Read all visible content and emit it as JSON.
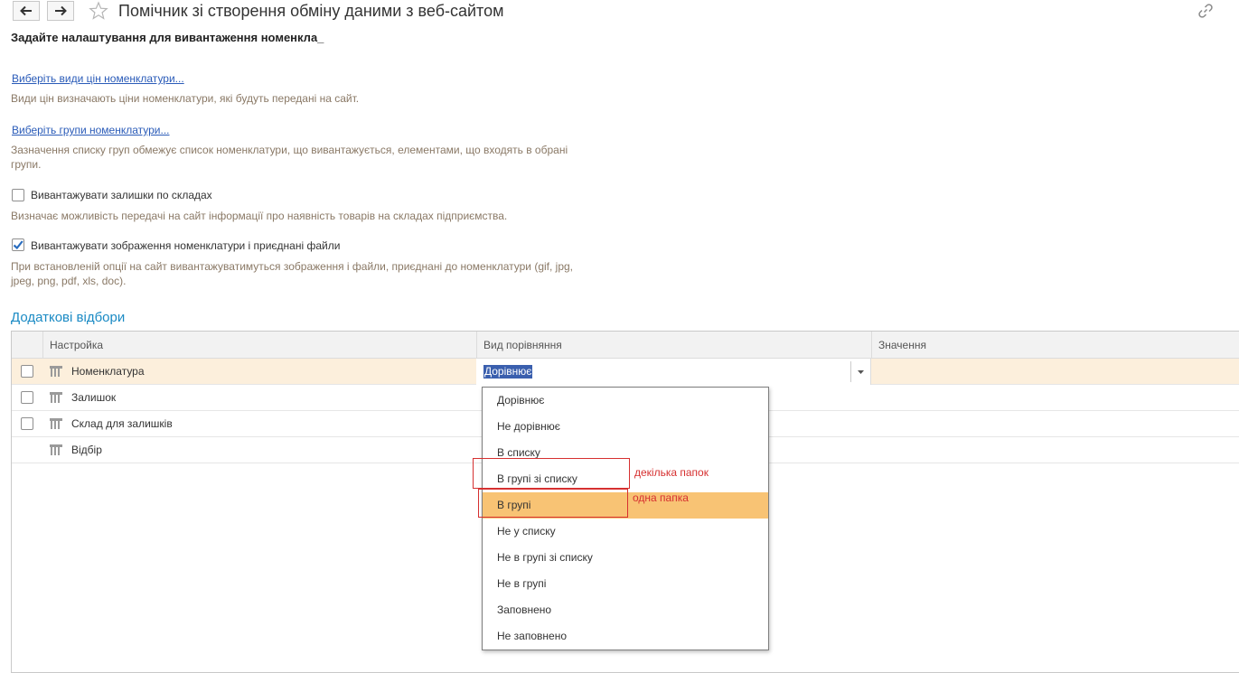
{
  "window": {
    "title": "Помічник зі створення обміну даними з веб-сайтом",
    "back_icon": "arrow-left-icon",
    "forward_icon": "arrow-right-icon",
    "favorite_icon": "star-icon",
    "link_icon": "link-icon"
  },
  "subtitle": "Задайте налаштування для вивантаження номенкла_",
  "price_types": {
    "link": "Виберіть види цін номенклатури...",
    "hint": "Види цін визначають ціни номенклатури, які будуть передані на сайт."
  },
  "groups": {
    "link": "Виберіть групи номенклатури...",
    "hint": "Зазначення списку груп обмежує список номенклатури, що вивантажується, елементами, що входять в обрані групи."
  },
  "stock_option": {
    "label": "Вивантажувати залишки по складах",
    "checked": false,
    "hint": "Визначає можливість передачі на сайт інформації про наявність товарів на складах підприємства."
  },
  "images_option": {
    "label": "Вивантажувати зображення номенклатури і приєднані файли",
    "checked": true,
    "hint": "При встановленій опції на сайт вивантажуватимуться зображення і файли, приєднані до номенклатури (gif, jpg, jpeg, png, pdf, xls, doc)."
  },
  "filters": {
    "title": "Додаткові відбори",
    "columns": [
      "Настройка",
      "Вид порівняння",
      "Значення"
    ],
    "rows": [
      {
        "label": "Номенклатура",
        "checked": false,
        "comparison": "Дорівнює"
      },
      {
        "label": "Залишок",
        "checked": false
      },
      {
        "label": "Склад для залишків",
        "checked": false
      },
      {
        "label": "Відбір"
      }
    ]
  },
  "dropdown": {
    "options": [
      "Дорівнює",
      "Не дорівнює",
      "В списку",
      "В групі зі списку",
      "В групі",
      "Не у списку",
      "Не в групі зі списку",
      "Не в групі",
      "Заповнено",
      "Не заповнено"
    ],
    "highlighted": "В групі"
  },
  "annotations": {
    "note_multi": "декілька папок",
    "note_single": "одна папка",
    "color": "#d63030"
  },
  "colors": {
    "link": "#2a5bb8",
    "hint": "#8a7966",
    "section": "#1a8ac4",
    "selected_row": "#fcefdc",
    "highlight": "#f8c374"
  }
}
